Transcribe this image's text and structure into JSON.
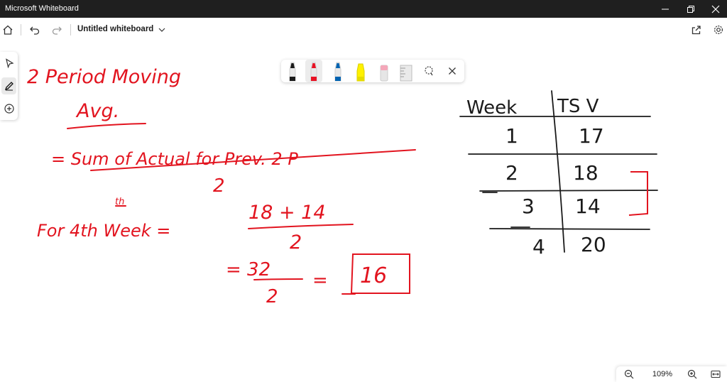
{
  "titlebar": {
    "app_name": "Microsoft Whiteboard"
  },
  "appbar": {
    "board_title": "Untitled whiteboard"
  },
  "zoom": {
    "level": "109%"
  },
  "colors": {
    "ink": "#e2141f",
    "table_ink": "#1a1a1a",
    "titlebar_bg": "#1f1f1f"
  },
  "pen_toolbar": {
    "tools": [
      {
        "name": "black-pen",
        "color": "#1a1a1a"
      },
      {
        "name": "red-pen",
        "color": "#e81123",
        "selected": true
      },
      {
        "name": "blue-pen",
        "color": "#0063b1"
      },
      {
        "name": "yellow-highlighter",
        "color": "#fff100"
      },
      {
        "name": "eraser",
        "color": "#f4a7b9"
      },
      {
        "name": "ruler",
        "color": "#c8c8c8"
      },
      {
        "name": "lasso",
        "color": "#1a1a1a"
      }
    ]
  },
  "whiteboard": {
    "heading_line1": "2 Period Moving",
    "heading_line2": "Avg.",
    "formula_numerator": "= Sum of Actual for Prev. 2 P",
    "formula_denominator": "2",
    "week_label": "For 4th Week =",
    "calc_numerator": "18 + 14",
    "calc_denominator": "2",
    "result_numerator": "= 32",
    "result_denominator": "2",
    "result_equals": "=",
    "result_value": "16",
    "table": {
      "headers": [
        "Week",
        "TS V"
      ],
      "rows": [
        [
          "1",
          "17"
        ],
        [
          "2",
          "18"
        ],
        [
          "3",
          "14"
        ],
        [
          "4",
          "20"
        ]
      ]
    }
  }
}
